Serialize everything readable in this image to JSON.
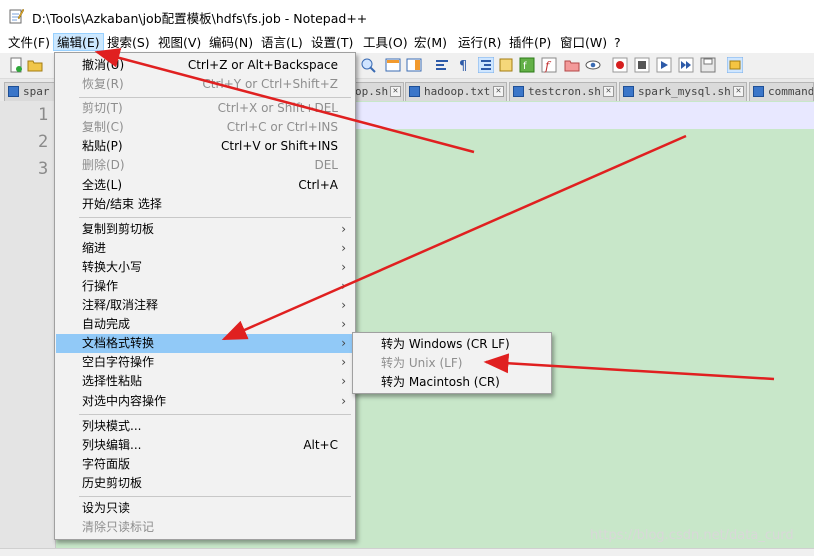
{
  "window": {
    "title": "D:\\Tools\\Azkaban\\job配置模板\\hdfs\\fs.job - Notepad++"
  },
  "menubar": {
    "items": [
      {
        "label": "文件(F)"
      },
      {
        "label": "编辑(E)",
        "active": true
      },
      {
        "label": "搜索(S)"
      },
      {
        "label": "视图(V)"
      },
      {
        "label": "编码(N)"
      },
      {
        "label": "语言(L)"
      },
      {
        "label": "设置(T)"
      },
      {
        "label": "工具(O)"
      },
      {
        "label": "宏(M)"
      },
      {
        "label": "运行(R)"
      },
      {
        "label": "插件(P)"
      },
      {
        "label": "窗口(W)"
      },
      {
        "label": "?"
      }
    ]
  },
  "tabs": [
    {
      "label": "spar"
    },
    {
      "label": "op.sh"
    },
    {
      "label": "hadoop.txt"
    },
    {
      "label": "testcron.sh"
    },
    {
      "label": "spark_mysql.sh"
    },
    {
      "label": "command"
    }
  ],
  "editor": {
    "line_numbers": [
      "1",
      "2",
      "3"
    ],
    "background_color": "#c8e7c9",
    "current_line_color": "#e8e8ff"
  },
  "edit_menu": {
    "items": [
      {
        "label": "撤消(U)",
        "shortcut": "Ctrl+Z or Alt+Backspace",
        "disabled": false
      },
      {
        "label": "恢复(R)",
        "shortcut": "Ctrl+Y or Ctrl+Shift+Z",
        "disabled": true
      },
      {
        "label": "剪切(T)",
        "shortcut": "Ctrl+X or Shift+DEL",
        "disabled": true
      },
      {
        "label": "复制(C)",
        "shortcut": "Ctrl+C or Ctrl+INS",
        "disabled": true
      },
      {
        "label": "粘贴(P)",
        "shortcut": "Ctrl+V or Shift+INS",
        "disabled": false
      },
      {
        "label": "删除(D)",
        "shortcut": "DEL",
        "disabled": true
      },
      {
        "label": "全选(L)",
        "shortcut": "Ctrl+A",
        "disabled": false
      },
      {
        "label": "开始/结束 选择",
        "shortcut": "",
        "disabled": false
      },
      {
        "label": "复制到剪切板",
        "submenu": true
      },
      {
        "label": "缩进",
        "submenu": true
      },
      {
        "label": "转换大小写",
        "submenu": true
      },
      {
        "label": "行操作",
        "submenu": true
      },
      {
        "label": "注释/取消注释",
        "submenu": true
      },
      {
        "label": "自动完成",
        "submenu": true
      },
      {
        "label": "文档格式转换",
        "submenu": true,
        "highlighted": true
      },
      {
        "label": "空白字符操作",
        "submenu": true
      },
      {
        "label": "选择性粘贴",
        "submenu": true
      },
      {
        "label": "对选中内容操作",
        "submenu": true
      },
      {
        "label": "列块模式...",
        "shortcut": "",
        "disabled": false
      },
      {
        "label": "列块编辑...",
        "shortcut": "Alt+C",
        "disabled": false
      },
      {
        "label": "字符面版",
        "shortcut": "",
        "disabled": false
      },
      {
        "label": "历史剪切板",
        "shortcut": "",
        "disabled": false
      },
      {
        "label": "设为只读",
        "shortcut": "",
        "disabled": false
      },
      {
        "label": "清除只读标记",
        "shortcut": "",
        "disabled": true
      }
    ],
    "submenu_arrow": "›"
  },
  "eol_submenu": {
    "items": [
      {
        "label": "转为 Windows (CR LF)",
        "disabled": false
      },
      {
        "label": "转为 Unix (LF)",
        "disabled": true
      },
      {
        "label": "转为 Macintosh (CR)",
        "disabled": false
      }
    ]
  },
  "watermark": "https://blog.csdn.net/data_curd",
  "colors": {
    "highlight": "#91c9f7",
    "annotation_arrow": "#e02020"
  }
}
